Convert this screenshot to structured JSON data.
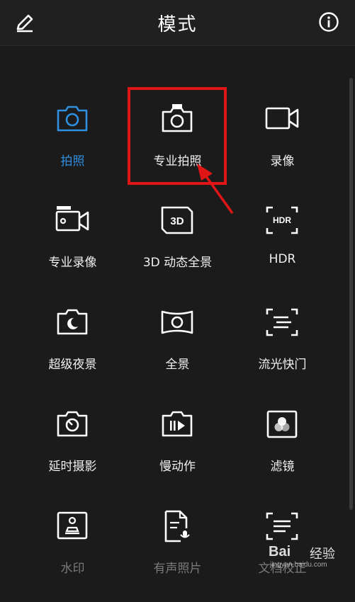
{
  "header": {
    "title": "模式",
    "edit_icon": "pencil-icon",
    "info_icon": "info-icon"
  },
  "modes": [
    {
      "label": "拍照",
      "icon": "camera-icon",
      "state": "selected"
    },
    {
      "label": "专业拍照",
      "icon": "pro-camera-icon",
      "state": "normal"
    },
    {
      "label": "录像",
      "icon": "video-camera-icon",
      "state": "normal"
    },
    {
      "label": "专业录像",
      "icon": "pro-video-icon",
      "state": "normal"
    },
    {
      "label": "3D 动态全景",
      "icon": "3d-panorama-icon",
      "state": "normal"
    },
    {
      "label": "HDR",
      "icon": "hdr-icon",
      "state": "normal"
    },
    {
      "label": "超级夜景",
      "icon": "night-mode-icon",
      "state": "normal"
    },
    {
      "label": "全景",
      "icon": "panorama-icon",
      "state": "normal"
    },
    {
      "label": "流光快门",
      "icon": "light-painting-icon",
      "state": "normal"
    },
    {
      "label": "延时摄影",
      "icon": "time-lapse-icon",
      "state": "normal"
    },
    {
      "label": "慢动作",
      "icon": "slow-motion-icon",
      "state": "normal"
    },
    {
      "label": "滤镜",
      "icon": "filter-icon",
      "state": "normal"
    },
    {
      "label": "水印",
      "icon": "watermark-icon",
      "state": "dim"
    },
    {
      "label": "有声照片",
      "icon": "audio-photo-icon",
      "state": "dim"
    },
    {
      "label": "文档校正",
      "icon": "document-scan-icon",
      "state": "dim"
    }
  ],
  "annotation": {
    "highlighted_mode": "专业拍照",
    "color": "#e01515"
  },
  "icon_texts": {
    "three_d": "3D",
    "hdr": "HDR"
  },
  "watermark": {
    "brand": "Bai",
    "cn": "经验",
    "sub": "jingyan.baidu.com"
  },
  "colors": {
    "accent": "#2f8fe0",
    "background": "#1b1b1b",
    "header": "#202020"
  }
}
